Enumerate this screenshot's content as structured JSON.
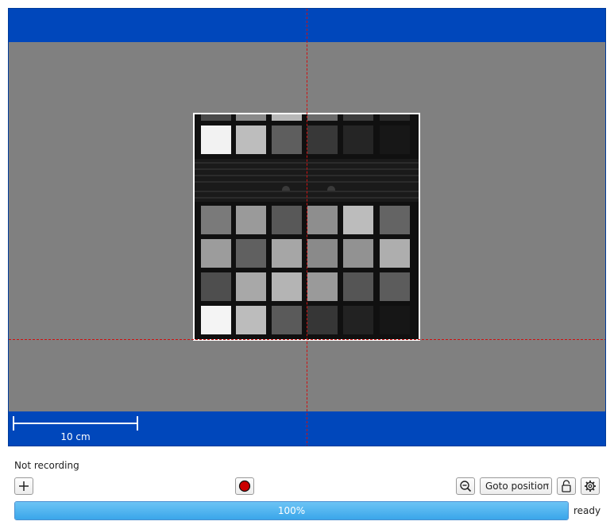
{
  "viewer": {
    "scale_label": "10 cm",
    "colors": {
      "frame": "#0047bb",
      "stage": "#808080",
      "crosshair": "#d01010"
    }
  },
  "camera_image": {
    "description_rows": "grayscale calibration target, top row partially visible",
    "top_row": [
      "#4a4a4a",
      "#8a8a8a",
      "#b8b8b8",
      "#6a6a6a",
      "#3c3c3c",
      "#2a2a2a"
    ],
    "rows": [
      [
        "#f2f2f2",
        "#bdbdbd",
        "#5e5e5e",
        "#383838",
        "#252525",
        "#171717"
      ],
      [
        "#7a7a7a",
        "#9a9a9a",
        "#585858",
        "#8e8e8e",
        "#bcbcbc",
        "#646464"
      ],
      [
        "#9c9c9c",
        "#606060",
        "#a6a6a6",
        "#8a8a8a",
        "#929292",
        "#aeaeae"
      ],
      [
        "#4e4e4e",
        "#a8a8a8",
        "#b4b4b4",
        "#9a9a9a",
        "#555555",
        "#5c5c5c"
      ],
      [
        "#f4f4f4",
        "#bcbcbc",
        "#5a5a5a",
        "#363636",
        "#222222",
        "#161616"
      ]
    ]
  },
  "status": {
    "recording": "Not recording",
    "state": "ready"
  },
  "toolbar": {
    "add_icon": "plus-icon",
    "record_icon": "record-icon",
    "zoom_icon": "zoom-out-icon",
    "goto_label": "Goto position",
    "lock_icon": "unlock-icon",
    "settings_icon": "gear-icon"
  },
  "progress": {
    "value": 1.0,
    "label": "100%"
  }
}
